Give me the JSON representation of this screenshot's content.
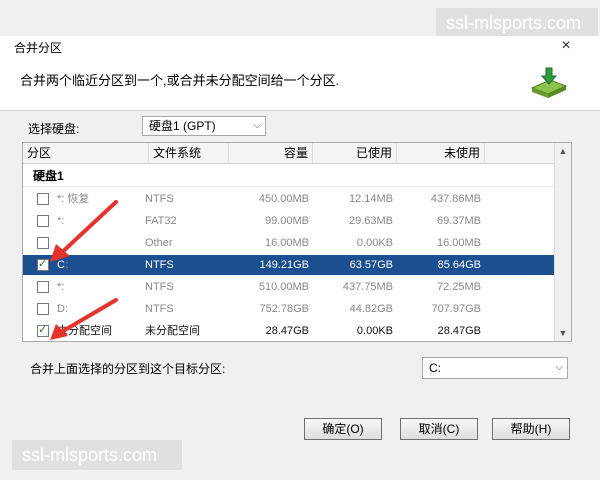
{
  "watermark": {
    "text": "ssl-mlsports.com"
  },
  "dialog": {
    "title": "合并分区",
    "close": "×",
    "description": "合并两个临近分区到一个,或合并未分配空间给一个分区."
  },
  "disk_select": {
    "label": "选择硬盘:",
    "value": "硬盘1 (GPT)"
  },
  "table": {
    "columns": [
      "分区",
      "文件系统",
      "容量",
      "已使用",
      "未使用"
    ],
    "group": "硬盘1",
    "rows": [
      {
        "name": "*: 恢复",
        "fs": "NTFS",
        "capacity": "450.00MB",
        "used": "12.14MB",
        "free": "437.86MB",
        "checked": false,
        "selected": false,
        "dark": false
      },
      {
        "name": "*:",
        "fs": "FAT32",
        "capacity": "99.00MB",
        "used": "29.63MB",
        "free": "69.37MB",
        "checked": false,
        "selected": false,
        "dark": false
      },
      {
        "name": "",
        "fs": "Other",
        "capacity": "16.00MB",
        "used": "0.00KB",
        "free": "16.00MB",
        "checked": false,
        "selected": false,
        "dark": false
      },
      {
        "name": "C:",
        "fs": "NTFS",
        "capacity": "149.21GB",
        "used": "63.57GB",
        "free": "85.64GB",
        "checked": true,
        "selected": true,
        "dark": false
      },
      {
        "name": "*:",
        "fs": "NTFS",
        "capacity": "510.00MB",
        "used": "437.75MB",
        "free": "72.25MB",
        "checked": false,
        "selected": false,
        "dark": false
      },
      {
        "name": "D:",
        "fs": "NTFS",
        "capacity": "752.78GB",
        "used": "44.82GB",
        "free": "707.97GB",
        "checked": false,
        "selected": false,
        "dark": false
      },
      {
        "name": "未分配空间",
        "fs": "未分配空间",
        "capacity": "28.47GB",
        "used": "0.00KB",
        "free": "28.47GB",
        "checked": true,
        "selected": false,
        "dark": true
      }
    ]
  },
  "target": {
    "label": "合并上面选择的分区到这个目标分区:",
    "value": "C:"
  },
  "buttons": {
    "ok": "确定(O)",
    "cancel": "取消(C)",
    "help": "帮助(H)"
  },
  "colors": {
    "selection": "#1b4f8f",
    "annotation_arrow": "#e5322b"
  }
}
